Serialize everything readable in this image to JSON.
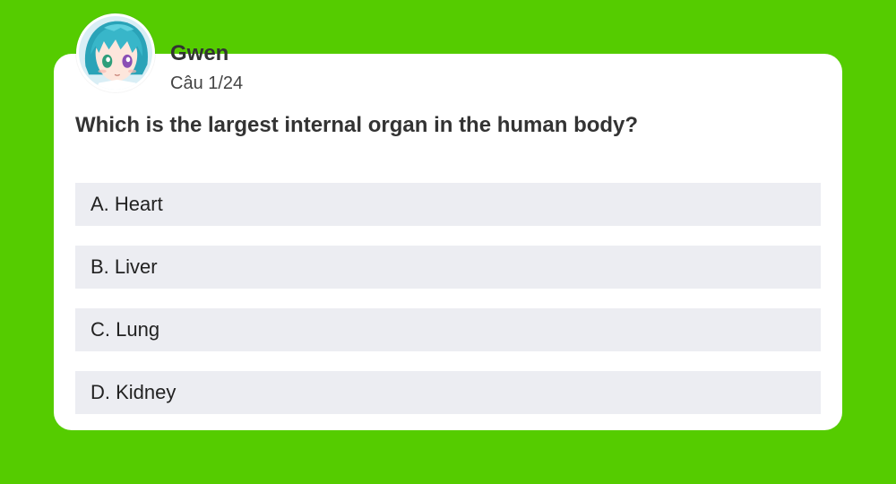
{
  "user": {
    "name": "Gwen",
    "counter": "Câu 1/24"
  },
  "question": {
    "text": "Which is the largest internal organ in the human body?"
  },
  "options": [
    {
      "label": "A. Heart"
    },
    {
      "label": "B. Liver"
    },
    {
      "label": "C. Lung"
    },
    {
      "label": "D. Kidney"
    }
  ],
  "colors": {
    "background": "#55cc00",
    "card": "#ffffff",
    "option_bg": "#ecedf2",
    "text": "#333333"
  },
  "icons": {
    "avatar": "anime-character-avatar"
  }
}
